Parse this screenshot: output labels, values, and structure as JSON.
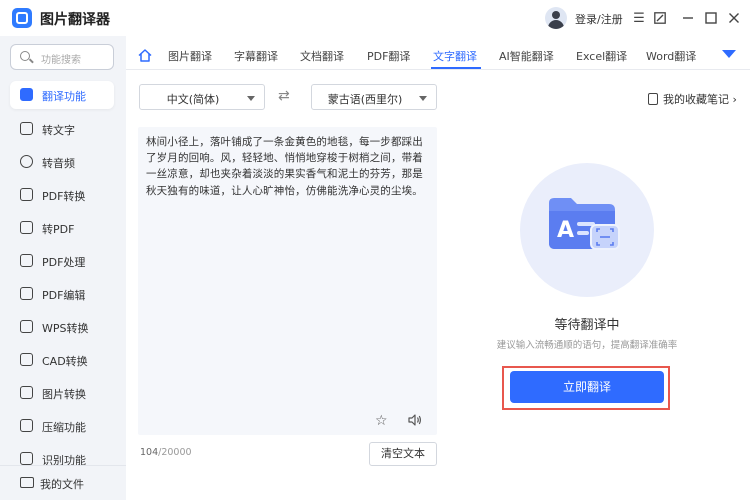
{
  "app": {
    "title": "图片翻译器"
  },
  "header": {
    "login_label": "登录/注册"
  },
  "sidebar": {
    "search_placeholder": "功能搜索",
    "items": [
      {
        "label": "翻译功能",
        "icon": "translate-icon",
        "active": true
      },
      {
        "label": "转文字",
        "icon": "text-icon"
      },
      {
        "label": "转音频",
        "icon": "audio-icon"
      },
      {
        "label": "PDF转换",
        "icon": "pdf-convert-icon"
      },
      {
        "label": "转PDF",
        "icon": "to-pdf-icon"
      },
      {
        "label": "PDF处理",
        "icon": "pdf-process-icon"
      },
      {
        "label": "PDF编辑",
        "icon": "pdf-edit-icon"
      },
      {
        "label": "WPS转换",
        "icon": "wps-icon"
      },
      {
        "label": "CAD转换",
        "icon": "cad-icon"
      },
      {
        "label": "图片转换",
        "icon": "image-icon"
      },
      {
        "label": "压缩功能",
        "icon": "compress-icon"
      },
      {
        "label": "识别功能",
        "icon": "recognize-icon"
      }
    ],
    "bottom_label": "我的文件"
  },
  "tabs": [
    {
      "label": "图片翻译"
    },
    {
      "label": "字幕翻译"
    },
    {
      "label": "文档翻译"
    },
    {
      "label": "PDF翻译"
    },
    {
      "label": "文字翻译",
      "active": true
    },
    {
      "label": "AI智能翻译"
    },
    {
      "label": "Excel翻译"
    },
    {
      "label": "Word翻译"
    }
  ],
  "lang": {
    "source": "中文(简体)",
    "target": "蒙古语(西里尔)"
  },
  "favorites_label": "我的收藏笔记",
  "input": {
    "text": "林间小径上，落叶铺成了一条金黄色的地毯，每一步都踩出了岁月的回响。风，轻轻地、悄悄地穿梭于树梢之间，带着一丝凉意，却也夹杂着淡淡的果实香气和泥土的芬芳，那是秋天独有的味道，让人心旷神怡，仿佛能洗净心灵的尘埃。",
    "count": "104",
    "max": "/20000"
  },
  "clear_label": "清空文本",
  "result": {
    "waiting_title": "等待翻译中",
    "hint": "建议输入流畅通顺的语句，提高翻译准确率"
  },
  "translate_label": "立即翻译",
  "colors": {
    "accent": "#2f6bff",
    "highlight": "#e8574d"
  }
}
